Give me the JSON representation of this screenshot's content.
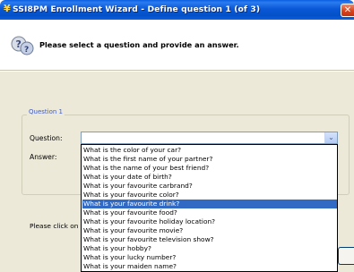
{
  "window": {
    "title": "SSI8PM Enrollment Wizard - Define question 1 (of 3)",
    "close_glyph": "✕",
    "title_icon": "key-icon"
  },
  "header": {
    "text": "Please select a question and provide an answer.",
    "icon": "question-keys-icon"
  },
  "group": {
    "legend": "Question 1",
    "question_label": "Question:",
    "answer_label": "Answer:"
  },
  "combo": {
    "value": "",
    "arrow_glyph": "⌄"
  },
  "dropdown": {
    "selected_index": 6,
    "options": [
      "What is the color of your car?",
      "What is the first name of your partner?",
      "What is the name of your best friend?",
      "What is your date of birth?",
      "What is your favourite carbrand?",
      "What is your favourite color?",
      "What is your favourite drink?",
      "What is your favourite food?",
      "What is your favourite holiday location?",
      "What is your favourite movie?",
      "What is your favourite television show?",
      "What is your hobby?",
      "What is your lucky number?",
      "What is your maiden name?"
    ]
  },
  "footer": {
    "instruction_visible": "Please click on th"
  },
  "colors": {
    "titlebar": "#0a58d6",
    "selection": "#316ac5",
    "dialog_bg": "#ece9d8",
    "legend": "#3b5bd6"
  }
}
